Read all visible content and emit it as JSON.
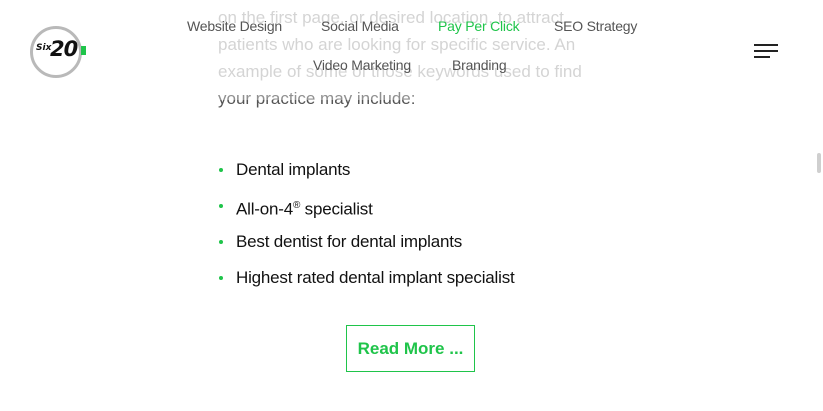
{
  "logo": {
    "small_text": "Six",
    "number": "20",
    "accent_color": "#1fc44a"
  },
  "nav": {
    "items": [
      {
        "label": "Website Design"
      },
      {
        "label": "Social Media"
      },
      {
        "label": "Pay Per Click",
        "active": true
      },
      {
        "label": "SEO Strategy"
      },
      {
        "label": "Video Marketing"
      },
      {
        "label": "Branding"
      }
    ],
    "menu_icon": "hamburger-menu-icon"
  },
  "content": {
    "paragraph_lines": [
      "on the first page, or desired location, to attract",
      "patients who are looking for specific service. An",
      "example of some of those keywords used to find",
      "your practice may include:"
    ],
    "bullets": [
      {
        "text": "Dental implants",
        "sup": ""
      },
      {
        "text": "All-on-4",
        "sup": "®",
        "suffix": " specialist"
      },
      {
        "text": "Best dentist for dental implants",
        "sup": ""
      },
      {
        "text": "Highest rated dental implant specialist",
        "sup": ""
      }
    ],
    "read_more_label": "Read More ..."
  },
  "colors": {
    "accent": "#1fc44a",
    "text": "#111111",
    "nav_text": "#555555"
  }
}
